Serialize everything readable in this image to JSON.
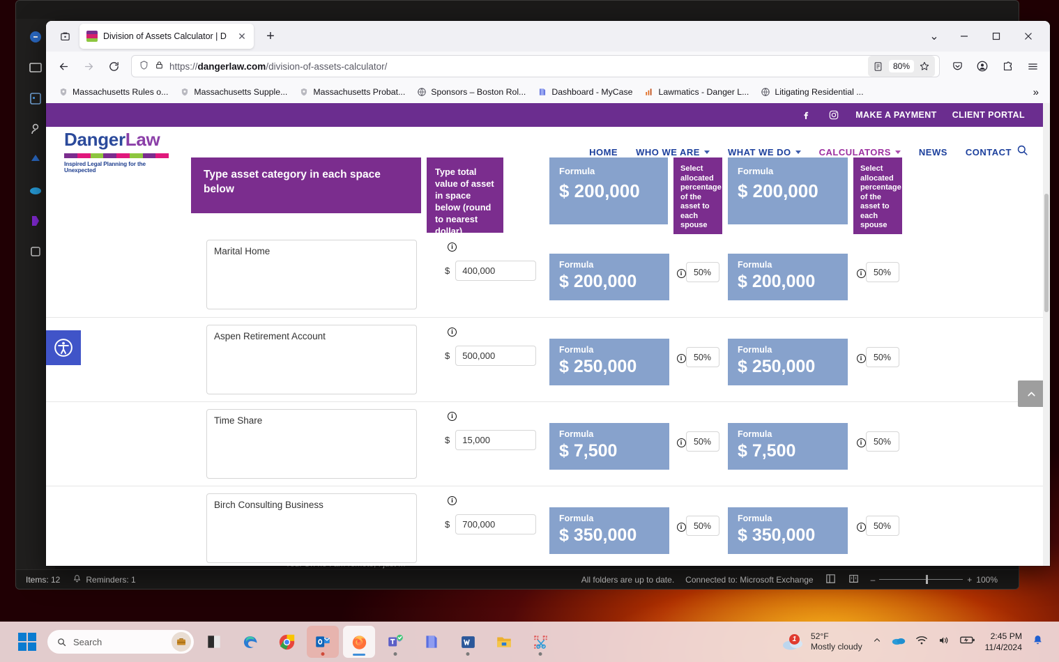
{
  "browser": {
    "tab": {
      "title": "Division of Assets Calculator | D",
      "close_label": "✕"
    },
    "newtab_label": "+",
    "url": {
      "prefix": "https://",
      "domain": "dangerlaw.com",
      "path": "/division-of-assets-calculator/"
    },
    "zoom_level": "80%",
    "bookmarks": [
      {
        "label": "Massachusetts Rules o...",
        "icon": "shield-icon"
      },
      {
        "label": "Massachusetts Supple...",
        "icon": "shield-icon"
      },
      {
        "label": "Massachusetts Probat...",
        "icon": "shield-icon"
      },
      {
        "label": "Sponsors – Boston Rol...",
        "icon": "globe-icon"
      },
      {
        "label": "Dashboard - MyCase",
        "icon": "book-icon"
      },
      {
        "label": "Lawmatics - Danger L...",
        "icon": "chart-icon"
      },
      {
        "label": "Litigating Residential ...",
        "icon": "globe-icon"
      }
    ],
    "bookmarks_overflow": "»",
    "window_controls": {
      "minimize": "–",
      "maximize": "□",
      "close": "✕",
      "list_all_tabs": "⌄"
    }
  },
  "site": {
    "topbar": {
      "facebook": "facebook-icon",
      "instagram": "instagram-icon",
      "make_payment": "MAKE A PAYMENT",
      "client_portal": "CLIENT PORTAL"
    },
    "logo": {
      "part1": "Danger",
      "part2": "Law",
      "tagline": "Inspired Legal Planning for the Unexpected"
    },
    "nav": [
      {
        "label": "HOME",
        "dropdown": false,
        "active": false
      },
      {
        "label": "WHO WE ARE",
        "dropdown": true,
        "active": false
      },
      {
        "label": "WHAT WE DO",
        "dropdown": true,
        "active": false
      },
      {
        "label": "CALCULATORS",
        "dropdown": true,
        "active": true
      },
      {
        "label": "NEWS",
        "dropdown": false,
        "active": false
      },
      {
        "label": "CONTACT",
        "dropdown": false,
        "active": false
      }
    ],
    "search_icon": "search-icon",
    "accessibility_icon": "accessibility-icon",
    "scroll_top_icon": "chevron-up-icon"
  },
  "calculator": {
    "headers": {
      "category": "Type asset category in each space below",
      "value": "Type total value of asset in space below (round to nearest dollar)",
      "formula_label": "Formula",
      "spouse1_total": "$ 200,000",
      "spouse2_total": "$ 200,000",
      "percent_note": "Select allocated percentage of the asset to each spouse"
    },
    "formula_label": "Formula",
    "dollar_sign": "$",
    "rows": [
      {
        "category": "Marital Home",
        "value": "400,000",
        "formula1": "$ 200,000",
        "percent1": "50%",
        "formula2": "$ 200,000",
        "percent2": "50%"
      },
      {
        "category": "Aspen Retirement Account",
        "value": "500,000",
        "formula1": "$ 250,000",
        "percent1": "50%",
        "formula2": "$ 250,000",
        "percent2": "50%"
      },
      {
        "category": "Time Share",
        "value": "15,000",
        "formula1": "$ 7,500",
        "percent1": "50%",
        "formula2": "$ 7,500",
        "percent2": "50%"
      },
      {
        "category": "Birch Consulting Business",
        "value": "700,000",
        "formula1": "$ 350,000",
        "percent1": "50%",
        "formula2": "$ 350,000",
        "percent2": "50%"
      }
    ]
  },
  "outlook": {
    "items_count": "Items: 12",
    "reminders": "Reminders: 1",
    "sync_status": "All folders are up to date.",
    "connection": "Connected to: Microsoft Exchange",
    "zoom": "100%",
    "zoom_minus": "–",
    "zoom_plus": "+",
    "caption": "You: Oh no I am remote, I just m"
  },
  "taskbar": {
    "search_placeholder": "Search",
    "apps": [
      {
        "name": "file-explorer-icon"
      },
      {
        "name": "edge-icon"
      },
      {
        "name": "chrome-icon"
      },
      {
        "name": "outlook-icon"
      },
      {
        "name": "firefox-icon"
      },
      {
        "name": "teams-icon"
      },
      {
        "name": "mycase-icon"
      },
      {
        "name": "word-icon"
      },
      {
        "name": "folder-icon"
      },
      {
        "name": "snipping-tool-icon"
      }
    ],
    "weather": {
      "temp": "52°F",
      "condition": "Mostly cloudy",
      "badge": "1"
    },
    "clock": {
      "time": "2:45 PM",
      "date": "11/4/2024"
    }
  },
  "colors": {
    "brand_purple": "#6b2d8f",
    "header_purple": "#7b2d8e",
    "formula_blue": "#87a2cc",
    "nav_blue": "#1b3f9c",
    "nav_active": "#9c2fa0"
  }
}
